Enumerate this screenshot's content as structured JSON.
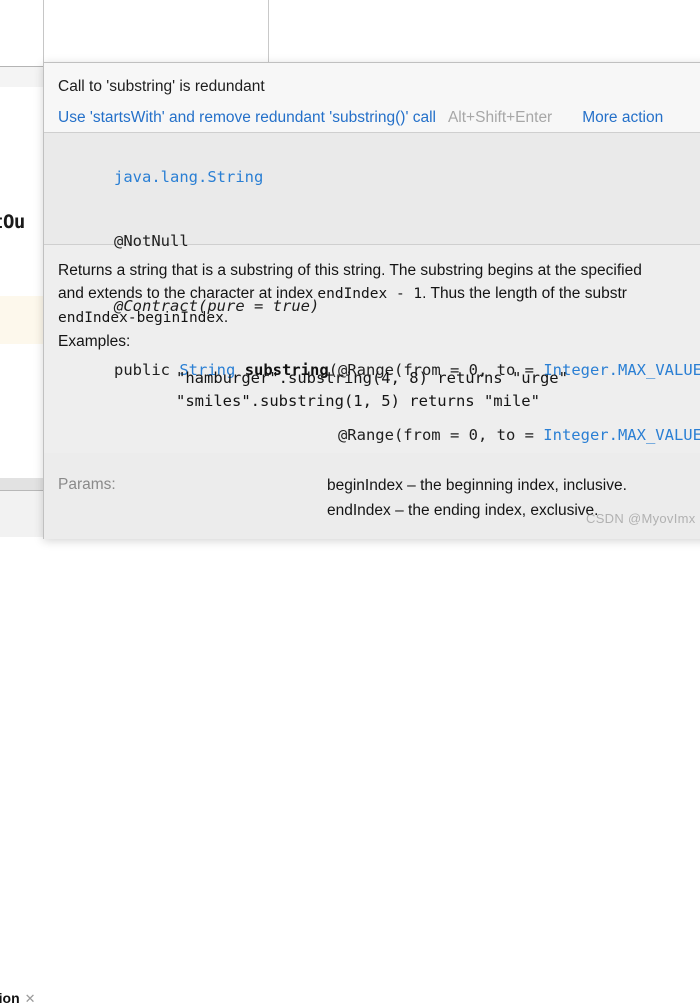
{
  "background": {
    "editor_code_fragment": "tOu",
    "tool_tab_label": "tion",
    "tool_tab_close_icon": "close-icon"
  },
  "popup": {
    "title": "Call to 'substring' is redundant",
    "action_link": "Use 'startsWith' and remove redundant 'substring()' call",
    "action_shortcut": "Alt+Shift+Enter",
    "more_actions": "More action",
    "signature": {
      "qualified_name": "java.lang.String",
      "annotation_notnull": "@NotNull",
      "annotation_contract_prefix": "@Contract(",
      "annotation_contract_body": "pure = true",
      "annotation_contract_suffix": ")",
      "modifier": "public",
      "return_type": "String",
      "method_name": "substring",
      "param1_open": "(@Range(from = ",
      "param1_from": "0",
      "param1_mid": ", to = ",
      "param1_to": "Integer.MAX_VALUE",
      "param1_close": ")",
      "param2_open": "@Range(from = ",
      "param2_from": "0",
      "param2_mid": ", to = ",
      "param2_to": "Integer.MAX_VALUE",
      "param2_close": ")"
    },
    "doc": {
      "paragraph_a": "Returns a string that is a substring of this string. The substring begins at the specified",
      "paragraph_b_pre": "and extends to the character at index ",
      "paragraph_b_mono": "endIndex - 1",
      "paragraph_b_post": ". Thus the length of the substr",
      "paragraph_c_mono": "endIndex-beginIndex",
      "paragraph_c_post": ".",
      "examples_label": "Examples:",
      "example_1": "\"hamburger\".substring(4, 8) returns \"urge\"",
      "example_2": "\"smiles\".substring(1, 5) returns \"mile\""
    },
    "params": {
      "label": "Params:",
      "lines": [
        "beginIndex – the beginning index, inclusive.",
        "endIndex – the ending index, exclusive."
      ]
    }
  },
  "watermark": {
    "text": "CSDN @MyovImx"
  },
  "colors": {
    "link": "#2470c9",
    "shortcut": "#a7a7a7",
    "code_type": "#2a7fd4",
    "popup_bg": "#f2f2f2",
    "signature_bg": "#eaeaea",
    "doc_bg": "#eeeeee",
    "caret_line": "#fdf8ec"
  }
}
